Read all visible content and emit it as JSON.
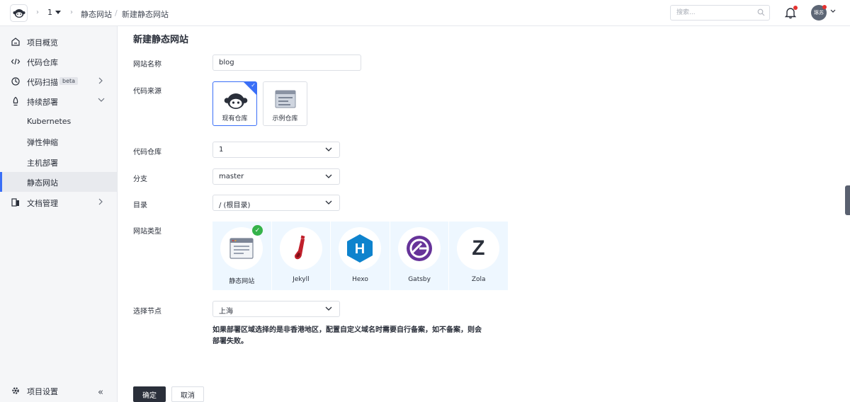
{
  "header": {
    "project": "1",
    "breadcrumbs": [
      "静态网站",
      "新建静态网站"
    ],
    "search_placeholder": "搜索...",
    "user_initials": "琢苏"
  },
  "sidebar": {
    "items": [
      {
        "label": "项目概览",
        "icon": "home-icon"
      },
      {
        "label": "代码仓库",
        "icon": "code-icon"
      },
      {
        "label": "代码扫描",
        "badge": "beta",
        "icon": "scan-icon"
      },
      {
        "label": "持续部署",
        "icon": "rocket-icon"
      },
      {
        "label": "Kubernetes"
      },
      {
        "label": "弹性伸缩"
      },
      {
        "label": "主机部署"
      },
      {
        "label": "静态网站"
      },
      {
        "label": "文档管理",
        "icon": "doc-icon"
      }
    ],
    "settings_label": "项目设置"
  },
  "form": {
    "title": "新建静态网站",
    "site_name_label": "网站名称",
    "site_name_value": "blog",
    "source_label": "代码来源",
    "source_options": [
      "现有仓库",
      "示例仓库"
    ],
    "repo_label": "代码仓库",
    "repo_value": "1",
    "branch_label": "分支",
    "branch_value": "master",
    "dir_label": "目录",
    "dir_value": "/ (根目录)",
    "type_label": "网站类型",
    "types": [
      "静态网站",
      "Jekyll",
      "Hexo",
      "Gatsby",
      "Zola"
    ],
    "type_icon_letters": {
      "hexo": "H",
      "zola": "Z"
    },
    "node_label": "选择节点",
    "node_value": "上海",
    "note": "如果部署区域选择的是非香港地区，配置自定义域名时需要自行备案，如不备案，则会部署失败。",
    "ok": "确定",
    "cancel": "取消"
  },
  "colors": {
    "accent": "#3a6ff7",
    "success": "#35b34a",
    "hexo": "#0e83cd",
    "gatsby": "#663399"
  }
}
